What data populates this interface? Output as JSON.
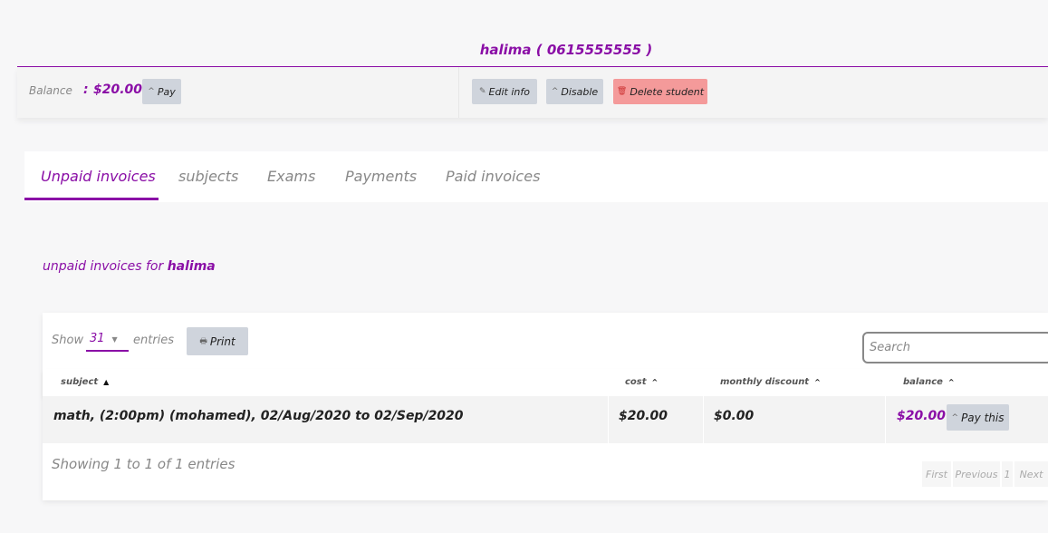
{
  "header": {
    "student_name": "halima",
    "student_phone": "( 0615555555 )",
    "balance_label": "Balance",
    "balance_colon": ":",
    "balance_value": "$20.00",
    "pay_label": "Pay",
    "edit_label": "Edit info",
    "disable_label": "Disable",
    "delete_label": "Delete student"
  },
  "tabs": [
    {
      "label": "Unpaid invoices",
      "active": true
    },
    {
      "label": "subjects",
      "active": false
    },
    {
      "label": "Exams",
      "active": false
    },
    {
      "label": "Payments",
      "active": false
    },
    {
      "label": "Paid invoices",
      "active": false
    }
  ],
  "section": {
    "heading_prefix": "unpaid invoices for",
    "heading_name": "halima"
  },
  "table": {
    "show_label": "Show",
    "entries_value": "31",
    "entries_label": "entries",
    "print_label": "Print",
    "search_placeholder": "Search",
    "columns": [
      "subject",
      "cost",
      "monthly discount",
      "balance"
    ],
    "rows": [
      {
        "subject": "math, (2:00pm) (mohamed), 02/Aug/2020 to 02/Sep/2020",
        "cost": "$20.00",
        "discount": "$0.00",
        "balance": "$20.00",
        "action": "Pay this"
      }
    ],
    "info": "Showing 1 to 1 of 1 entries",
    "pagination": [
      "First",
      "Previous",
      "1",
      "Next"
    ]
  },
  "colors": {
    "accent": "#8a0ea6",
    "danger_button": "#f49a9a",
    "neutral_button": "#cfd4dc"
  }
}
